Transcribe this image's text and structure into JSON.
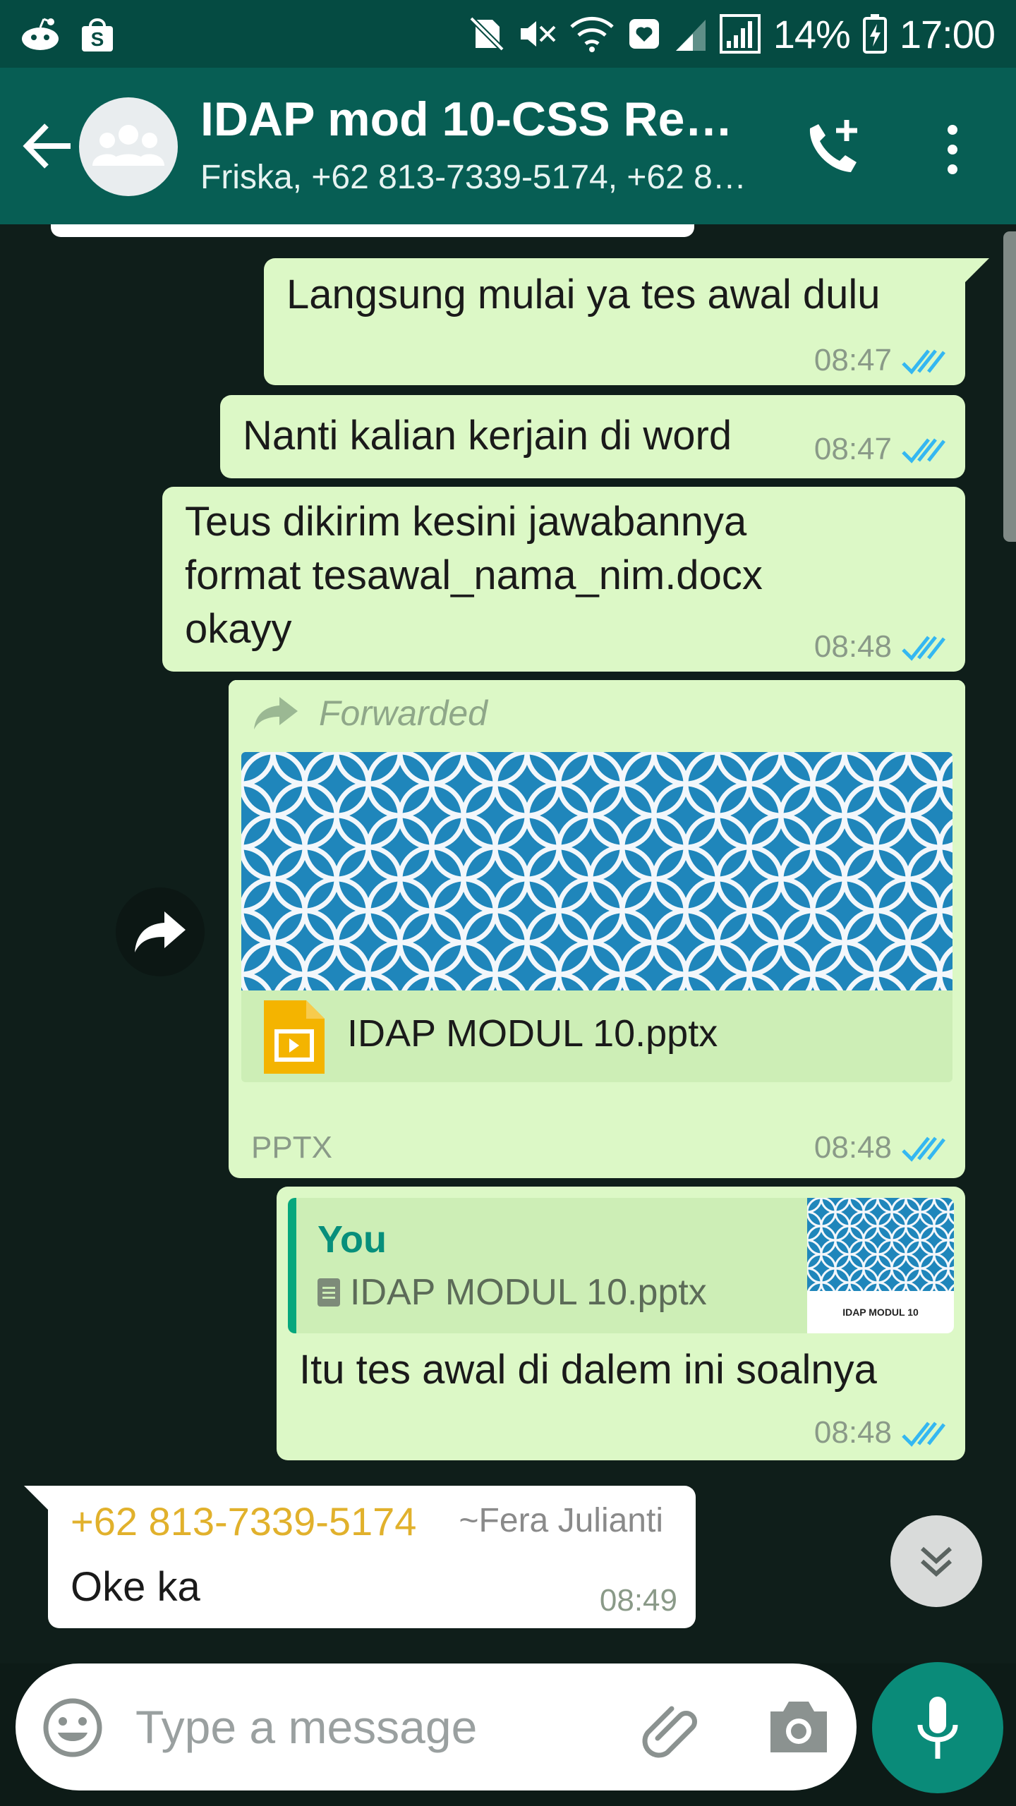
{
  "status_bar": {
    "battery": "14%",
    "time": "17:00"
  },
  "header": {
    "title": "IDAP mod 10-CSS Res…",
    "subtitle": "Friska, +62 813-7339-5174, +62 8…",
    "icons": [
      "back-arrow",
      "group-avatar",
      "add-call",
      "more-vertical"
    ]
  },
  "messages": [
    {
      "text": "Langsung mulai ya tes awal dulu",
      "time": "08:47",
      "status": "read"
    },
    {
      "text": "Nanti kalian kerjain di word",
      "time": "08:47",
      "status": "read"
    },
    {
      "lines": [
        "Teus dikirim kesini jawabannya",
        "format tesawal_nama_nim.docx",
        "okayy"
      ],
      "time": "08:48",
      "status": "read"
    },
    {
      "forwarded_label": "Forwarded",
      "file_name": "IDAP MODUL 10.pptx",
      "file_type": "PPTX",
      "time": "08:48",
      "status": "read"
    },
    {
      "quote_author": "You",
      "quote_file": "IDAP MODUL 10.pptx",
      "quote_thumb_label": "IDAP MODUL 10",
      "text": "Itu tes awal di dalem ini soalnya",
      "time": "08:48",
      "status": "read"
    },
    {
      "sender_phone": "+62 813-7339-5174",
      "sender_name": "~Fera Julianti",
      "text": "Oke ka",
      "time": "08:49"
    }
  ],
  "composer": {
    "placeholder": "Type a message"
  },
  "colors": {
    "header": "#075e54",
    "outgoing_bubble": "#dcf8c6",
    "incoming_bubble": "#ffffff",
    "read_ticks": "#34b7f1",
    "mic_button": "#0a8b79"
  }
}
